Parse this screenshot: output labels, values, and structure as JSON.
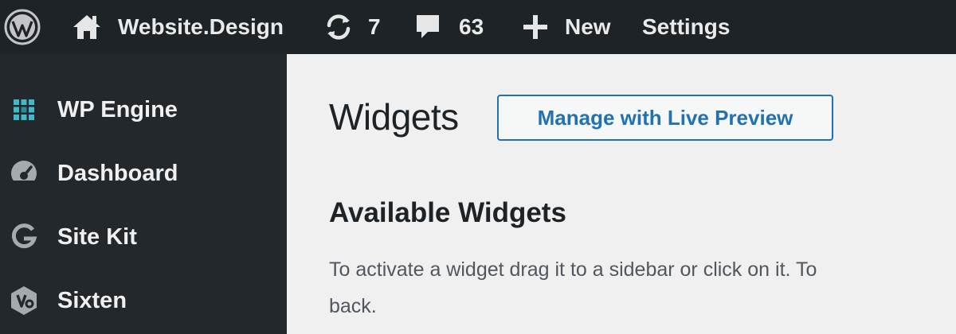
{
  "adminbar": {
    "site_name": "Website.Design",
    "updates_count": "7",
    "comments_count": "63",
    "new_label": "New",
    "settings_label": "Settings"
  },
  "sidebar": {
    "items": [
      {
        "label": "WP Engine",
        "icon": "wp-engine-icon"
      },
      {
        "label": "Dashboard",
        "icon": "dashboard-gauge-icon"
      },
      {
        "label": "Site Kit",
        "icon": "google-g-icon"
      },
      {
        "label": "Sixten",
        "icon": "sixten-hexagon-icon"
      }
    ]
  },
  "main": {
    "page_title": "Widgets",
    "live_preview_button": "Manage with Live Preview",
    "section_title": "Available Widgets",
    "description_line1": "To activate a widget drag it to a sidebar or click on it. To",
    "description_line2": "back."
  },
  "colors": {
    "adminbar_bg": "#1d2327",
    "sidebar_bg": "#23282d",
    "content_bg": "#f0f0f1",
    "accent_blue": "#2271b1",
    "wp_engine_teal": "#40bac8"
  }
}
